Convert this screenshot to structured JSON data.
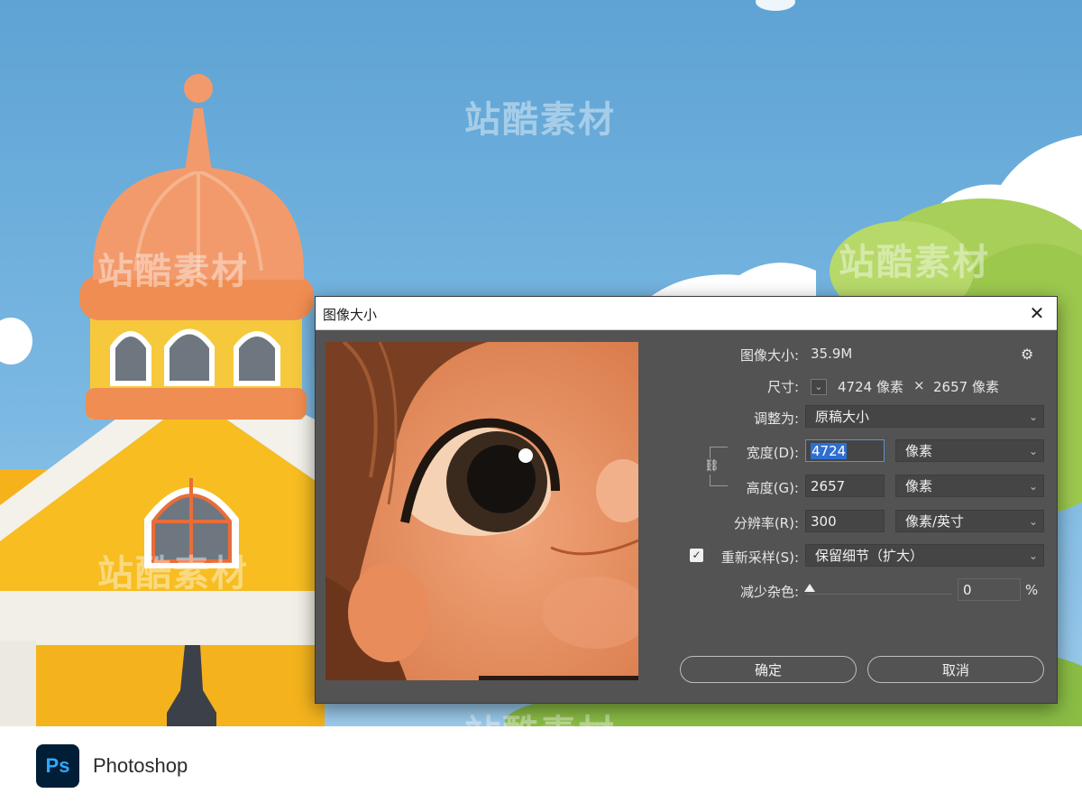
{
  "dialog": {
    "title": "图像大小",
    "close_glyph": "✕",
    "image_size_label": "图像大小:",
    "image_size_value": "35.9M",
    "settings_icon": "gear-icon",
    "dimensions_label": "尺寸:",
    "dimensions_width": "4724 像素",
    "dimensions_sep": "×",
    "dimensions_height": "2657 像素",
    "fit_to_label": "调整为:",
    "fit_to_value": "原稿大小",
    "width_label": "宽度(D):",
    "width_value": "4724",
    "width_unit": "像素",
    "height_label": "高度(G):",
    "height_value": "2657",
    "height_unit": "像素",
    "resolution_label": "分辨率(R):",
    "resolution_value": "300",
    "resolution_unit": "像素/英寸",
    "resample_checked": true,
    "resample_label": "重新采样(S):",
    "resample_value": "保留细节（扩大）",
    "noise_label": "减少杂色:",
    "noise_value": "0",
    "noise_unit": "%",
    "noise_level": 0,
    "ok_label": "确定",
    "cancel_label": "取消"
  },
  "footer": {
    "logo_text": "Ps",
    "app_name": "Photoshop"
  },
  "watermark": "站酷素材",
  "colors": {
    "dialog_bg": "#535353",
    "selection": "#2f6fd1",
    "ps_logo_bg": "#001e36",
    "ps_logo_fg": "#31a8ff"
  }
}
